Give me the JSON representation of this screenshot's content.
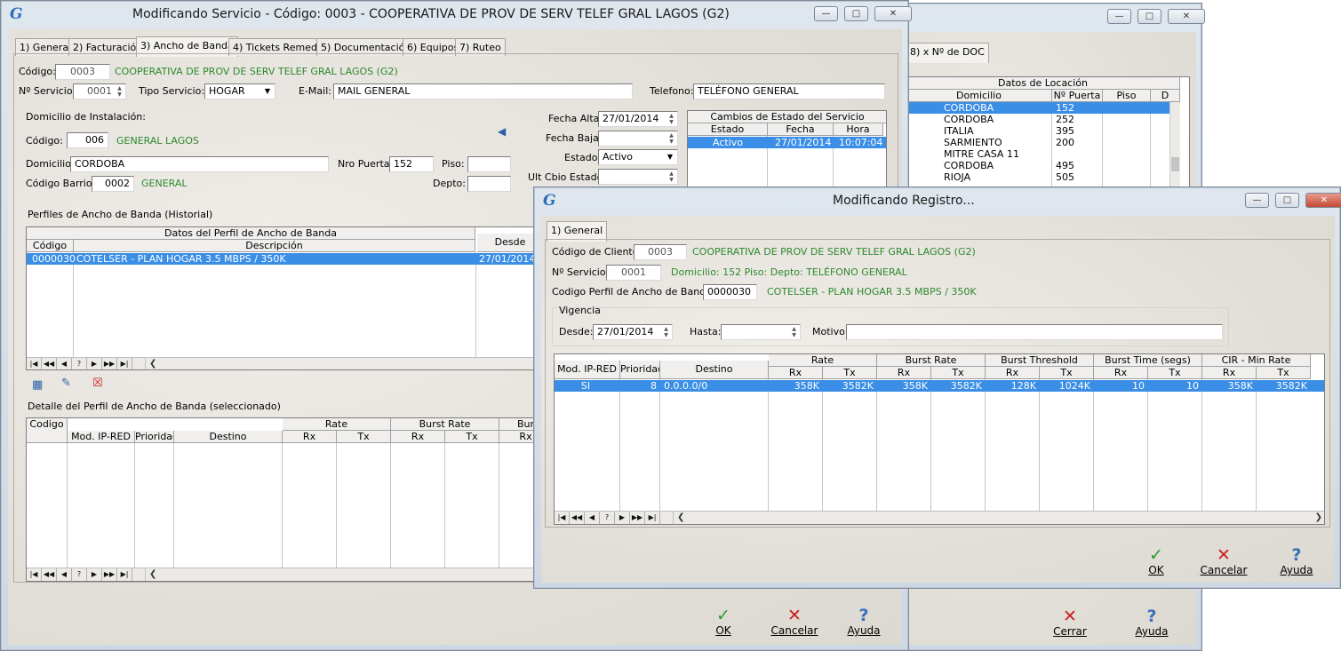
{
  "back_window": {
    "tab": "8) x Nº de DOC",
    "grid_header": "Datos de Locación",
    "columns": [
      "Domicilio",
      "Nº Puerta",
      "Piso",
      "D"
    ],
    "rows": [
      {
        "domicilio": "CORDOBA",
        "puerta": "152"
      },
      {
        "domicilio": "CORDOBA",
        "puerta": "252"
      },
      {
        "domicilio": "ITALIA",
        "puerta": "395"
      },
      {
        "domicilio": "SARMIENTO",
        "puerta": "200"
      },
      {
        "domicilio": "MITRE CASA 11",
        "puerta": ""
      },
      {
        "domicilio": "CORDOBA",
        "puerta": "495"
      },
      {
        "domicilio": "RIOJA",
        "puerta": "505"
      }
    ],
    "cerrar": "Cerrar",
    "ayuda": "Ayuda"
  },
  "main_window": {
    "title": "Modificando Servicio - Código: 0003 - COOPERATIVA DE PROV DE SERV TELEF GRAL LAGOS (G2)",
    "tabs": [
      "1) General",
      "2) Facturación",
      "3) Ancho de Banda",
      "4) Tickets Remedy",
      "5) Documentación",
      "6) Equipos",
      "7) Ruteo"
    ],
    "codigo_label": "Código:",
    "codigo": "0003",
    "codigo_desc": "COOPERATIVA DE PROV DE SERV TELEF GRAL LAGOS (G2)",
    "nservicio_label": "Nº Servicio:",
    "nservicio": "0001",
    "tipo_label": "Tipo Servicio:",
    "tipo": "HOGAR",
    "email_label": "E-Mail:",
    "email": "MAIL GENERAL",
    "telefono_label": "Telefono:",
    "telefono": "TELÉFONO GENERAL",
    "domicilio_inst_label": "Domicilio de Instalación:",
    "codigo2_label": "Código:",
    "codigo2": "006",
    "codigo2_desc": "GENERAL LAGOS",
    "domicilio_label": "Domicilio:",
    "domicilio": "CORDOBA",
    "nro_puerta_label": "Nro Puerta:",
    "nro_puerta": "152",
    "piso_label": "Piso:",
    "piso": "",
    "barrio_label": "Código Barrio:",
    "barrio": "0002",
    "barrio_desc": "GENERAL",
    "depto_label": "Depto:",
    "depto": "",
    "fecha_alta_label": "Fecha Alta:",
    "fecha_alta": "27/01/2014",
    "fecha_baja_label": "Fecha Baja:",
    "fecha_baja": "",
    "estado_label": "Estado:",
    "estado": "Activo",
    "ult_cbio_label": "Ult Cbio Estado:",
    "ult_cbio": "",
    "cambios_title": "Cambios de Estado del Servicio",
    "cambios_cols": [
      "Estado",
      "Fecha",
      "Hora"
    ],
    "cambios_row": {
      "estado": "Activo",
      "fecha": "27/01/2014",
      "hora": "10:07:04"
    },
    "perfiles_label": "Perfiles de Ancho de Banda (Historial)",
    "perfiles_group": "Datos del Perfil de Ancho de Banda",
    "perfiles_cols": [
      "Código",
      "Descripción",
      "Desde"
    ],
    "perfiles_row": {
      "codigo": "0000030",
      "descripcion": "COTELSER - PLAN HOGAR 3.5 MBPS / 350K",
      "desde": "27/01/2014"
    },
    "detalle_label": "Detalle del Perfil de Ancho de Banda (seleccionado)",
    "detalle_cols": [
      "Codigo",
      "Mod. IP-RED",
      "Prioridad",
      "Destino",
      "Rate",
      "Burst Rate",
      "Bur",
      "Rx",
      "Tx",
      "Rx",
      "Tx",
      "Rx"
    ],
    "ok": "OK",
    "cancelar": "Cancelar",
    "ayuda": "Ayuda"
  },
  "dialog": {
    "title": "Modificando Registro...",
    "tab": "1) General",
    "cliente_label": "Código de Cliente:",
    "cliente": "0003",
    "cliente_desc": "COOPERATIVA DE PROV DE SERV TELEF GRAL LAGOS (G2)",
    "nservicio_label": "Nº Servicio:",
    "nservicio": "0001",
    "nservicio_desc": "Domicilio: 152  Piso:  Depto: TELÉFONO GENERAL",
    "perfil_label": "Codigo Perfil de Ancho de Banda:",
    "perfil": "0000030",
    "perfil_desc": "COTELSER - PLAN HOGAR 3.5 MBPS / 350K",
    "vigencia_label": "Vigencia",
    "desde_label": "Desde:",
    "desde": "27/01/2014",
    "hasta_label": "Hasta:",
    "hasta": "",
    "motivo_label": "Motivo:",
    "motivo": "",
    "group_headers": [
      "Rate",
      "Burst Rate",
      "Burst Threshold",
      "Burst Time (segs)",
      "CIR - Min Rate"
    ],
    "cols": [
      "Mod. IP-RED",
      "Prioridad",
      "Destino",
      "Rx",
      "Tx",
      "Rx",
      "Tx",
      "Rx",
      "Tx",
      "Rx",
      "Tx",
      "Rx",
      "Tx"
    ],
    "row": [
      "SI",
      "8",
      "0.0.0.0/0",
      "358K",
      "3582K",
      "358K",
      "3582K",
      "128K",
      "1024K",
      "10",
      "10",
      "358K",
      "3582K"
    ],
    "ok": "OK",
    "cancelar": "Cancelar",
    "ayuda": "Ayuda"
  }
}
